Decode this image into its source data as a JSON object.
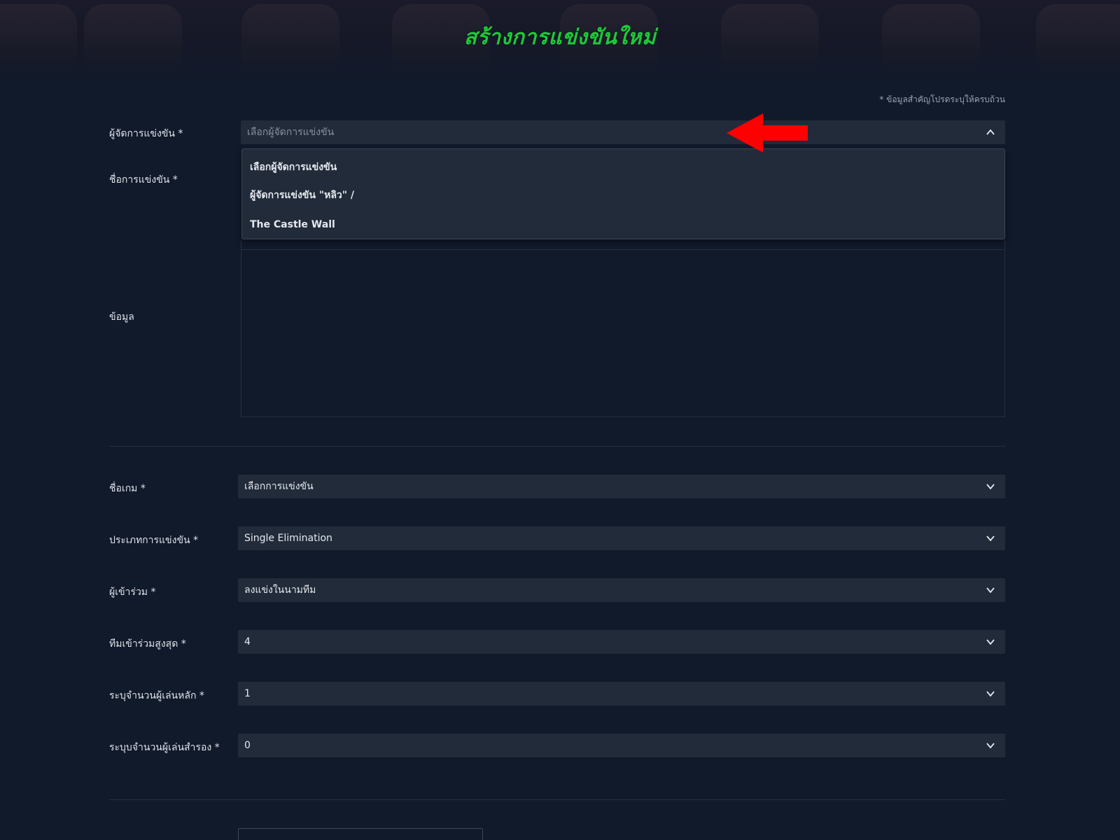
{
  "page": {
    "title": "สร้างการแข่งขันใหม่",
    "required_note": "* ข้อมูลสำคัญโปรดระบุให้ครบถ้วน"
  },
  "form": {
    "organizer": {
      "label": "ผู้จัดการแข่งขัน *",
      "placeholder": "เลือกผู้จัดการแข่งขัน",
      "options": [
        "เลือกผู้จัดการแข่งขัน",
        "ผู้จัดการแข่งขัน \"หลิว\" /",
        "The Castle Wall"
      ]
    },
    "tournament_name": {
      "label": "ชื่อการแข่งขัน *"
    },
    "info": {
      "label": "ข้อมูล"
    },
    "game_name": {
      "label": "ชื่อเกม *",
      "value": "เลือกการแข่งขัน"
    },
    "tournament_type": {
      "label": "ประเภทการแข่งขัน *",
      "value": "Single Elimination"
    },
    "participants": {
      "label": "ผู้เข้าร่วม *",
      "value": "ลงแข่งในนามทีม"
    },
    "max_teams": {
      "label": "ทีมเข้าร่วมสูงสุด *",
      "value": "4"
    },
    "main_players": {
      "label": "ระบุจำนวนผู้เล่นหลัก *",
      "value": "1"
    },
    "sub_players": {
      "label": "ระบุบจำนวนผู้เล่นสำรอง *",
      "value": "0"
    }
  },
  "icons": {
    "chevron_up": "chevron-up-icon",
    "chevron_down": "chevron-down-icon",
    "annotation_arrow": "red-arrow-icon"
  },
  "colors": {
    "background": "#111a2b",
    "field": "#212b3a",
    "title_green": "#1ec83a",
    "annotation_red": "#ff0000"
  }
}
